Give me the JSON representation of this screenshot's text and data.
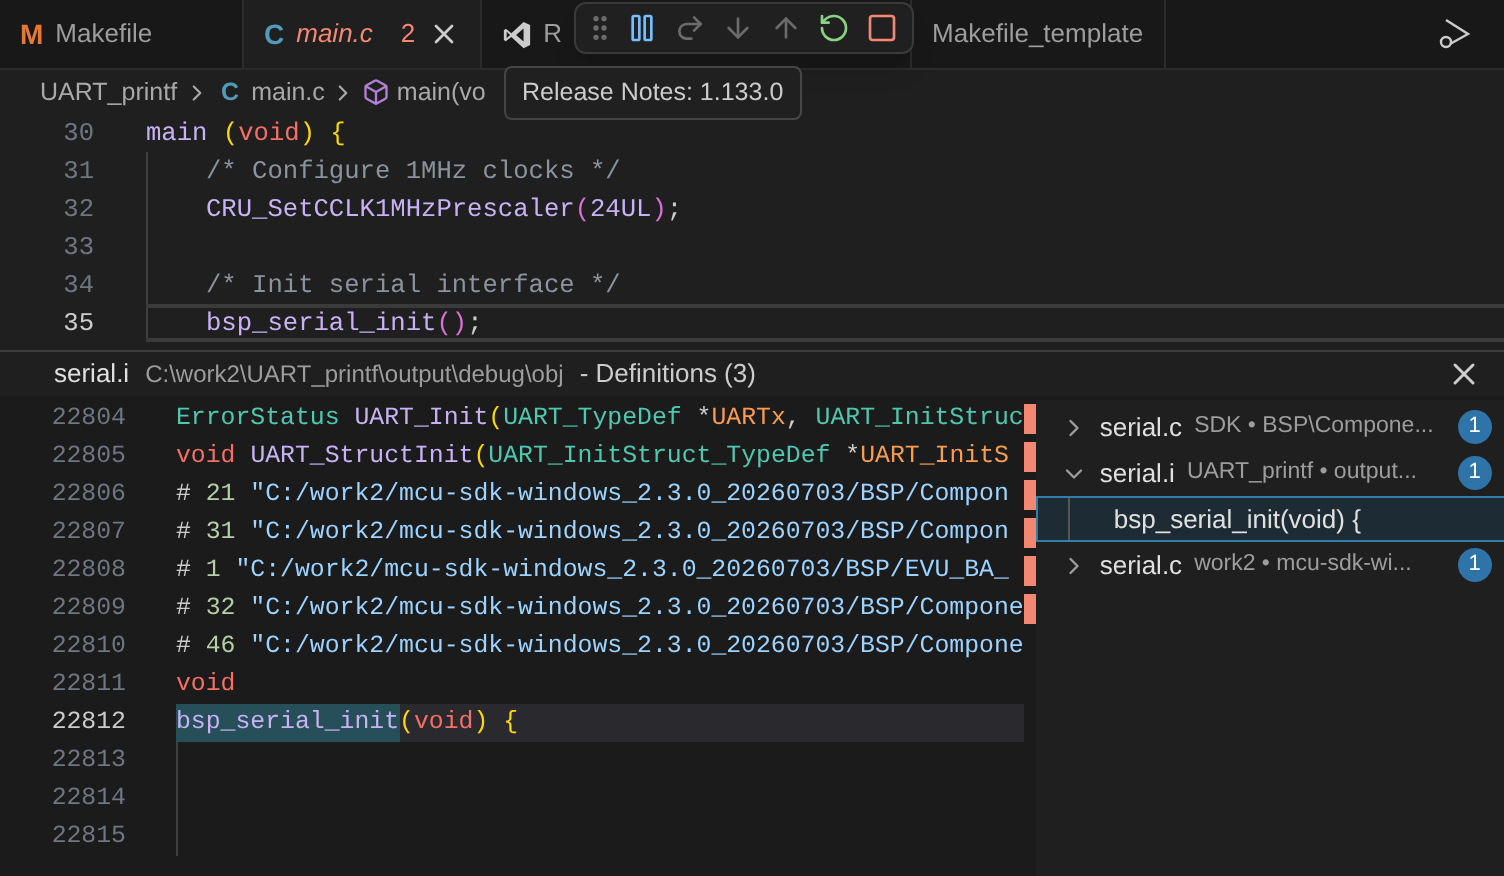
{
  "tabs": [
    {
      "label": "Makefile",
      "icon_text": "M",
      "kind": "makefile",
      "selected": false,
      "preview": false
    },
    {
      "label": "main.c",
      "icon_text": "C",
      "kind": "c",
      "selected": true,
      "preview": true,
      "errors": "2"
    },
    {
      "label": "R",
      "kind": "vscode",
      "selected": false,
      "preview": false
    },
    {
      "label": "Makefile_template",
      "kind": "plain",
      "selected": false,
      "preview": false
    }
  ],
  "debug_toolbar": [
    {
      "kind": "grip"
    },
    {
      "kind": "pause",
      "disabled": false
    },
    {
      "kind": "step_over",
      "disabled": true
    },
    {
      "kind": "step_into",
      "disabled": true
    },
    {
      "kind": "step_out",
      "disabled": true
    },
    {
      "kind": "restart",
      "disabled": false
    },
    {
      "kind": "stop",
      "disabled": false
    }
  ],
  "breadcrumb": [
    {
      "kind": "folder",
      "label": "UART_printf"
    },
    {
      "kind": "file",
      "icon_text": "C",
      "label": "main.c"
    },
    {
      "kind": "symbol",
      "label": "main(vo"
    }
  ],
  "tooltip": "Release Notes: 1.133.0",
  "editor": {
    "lines": [
      {
        "number": "30",
        "current": false,
        "indented": false,
        "tokens": [
          {
            "text": "main ",
            "kind": "fn"
          },
          {
            "text": "(",
            "kind": "br1"
          },
          {
            "text": "void",
            "kind": "kw"
          },
          {
            "text": ") {",
            "kind": "br1"
          }
        ]
      },
      {
        "number": "31",
        "current": false,
        "indented": true,
        "tokens": [
          {
            "text": "/* Configure 1MHz clocks */",
            "kind": "cmt"
          }
        ]
      },
      {
        "number": "32",
        "current": false,
        "indented": true,
        "tokens": [
          {
            "text": "CRU_SetCCLK1MHzPrescaler",
            "kind": "fn"
          },
          {
            "text": "(",
            "kind": "br2"
          },
          {
            "text": "24UL",
            "kind": "num"
          },
          {
            "text": ")",
            "kind": "br2"
          },
          {
            "text": ";",
            "kind": "plain"
          }
        ]
      },
      {
        "number": "33",
        "current": false,
        "indented": true
      },
      {
        "number": "34",
        "current": false,
        "indented": true,
        "tokens": [
          {
            "text": "/* Init serial interface */",
            "kind": "cmt"
          }
        ]
      },
      {
        "number": "35",
        "current": true,
        "indented": true,
        "tokens": [
          {
            "text": "bsp_serial_init",
            "kind": "fn"
          },
          {
            "text": "()",
            "kind": "br2"
          },
          {
            "text": ";",
            "kind": "plain"
          }
        ]
      }
    ]
  },
  "peek": {
    "file": "serial.i",
    "path": "C:\\work2\\UART_printf\\output\\debug\\obj",
    "title": "- Definitions (3)",
    "lines": [
      {
        "number": "22804",
        "current": false,
        "tokens": [
          {
            "text": "ErrorStatus ",
            "kind": "type"
          },
          {
            "text": "UART_Init",
            "kind": "fn"
          },
          {
            "text": "(",
            "kind": "br1"
          },
          {
            "text": "UART_TypeDef",
            "kind": "type"
          },
          {
            "text": " *",
            "kind": "plain"
          },
          {
            "text": "UARTx",
            "kind": "param"
          },
          {
            "text": ", ",
            "kind": "plain"
          },
          {
            "text": "UART_InitStruc",
            "kind": "type"
          }
        ]
      },
      {
        "number": "22805",
        "current": false,
        "tokens": [
          {
            "text": "void ",
            "kind": "kw"
          },
          {
            "text": "UART_StructInit",
            "kind": "fn"
          },
          {
            "text": "(",
            "kind": "br1"
          },
          {
            "text": "UART_InitStruct_TypeDef",
            "kind": "type"
          },
          {
            "text": " *",
            "kind": "plain"
          },
          {
            "text": "UART_InitS",
            "kind": "param"
          }
        ]
      },
      {
        "number": "22806",
        "current": false,
        "tokens": [
          {
            "text": "# ",
            "kind": "plain"
          },
          {
            "text": "21",
            "kind": "num2"
          },
          {
            "text": " \"C:/work2/mcu-sdk-windows_2.3.0_20260703/BSP/Compon",
            "kind": "str"
          }
        ]
      },
      {
        "number": "22807",
        "current": false,
        "tokens": [
          {
            "text": "# ",
            "kind": "plain"
          },
          {
            "text": "31",
            "kind": "num2"
          },
          {
            "text": " \"C:/work2/mcu-sdk-windows_2.3.0_20260703/BSP/Compon",
            "kind": "str"
          }
        ]
      },
      {
        "number": "22808",
        "current": false,
        "tokens": [
          {
            "text": "# ",
            "kind": "plain"
          },
          {
            "text": "1",
            "kind": "num2"
          },
          {
            "text": " \"C:/work2/mcu-sdk-windows_2.3.0_20260703/BSP/EVU_BA_",
            "kind": "str"
          }
        ]
      },
      {
        "number": "22809",
        "current": false,
        "tokens": [
          {
            "text": "# ",
            "kind": "plain"
          },
          {
            "text": "32",
            "kind": "num2"
          },
          {
            "text": " \"C:/work2/mcu-sdk-windows_2.3.0_20260703/BSP/Compone",
            "kind": "str"
          }
        ]
      },
      {
        "number": "22810",
        "current": false,
        "tokens": [
          {
            "text": "# ",
            "kind": "plain"
          },
          {
            "text": "46",
            "kind": "num2"
          },
          {
            "text": " \"C:/work2/mcu-sdk-windows_2.3.0_20260703/BSP/Compone",
            "kind": "str"
          }
        ]
      },
      {
        "number": "22811",
        "current": false,
        "tokens": [
          {
            "text": "void",
            "kind": "kw"
          }
        ]
      },
      {
        "number": "22812",
        "current": true,
        "tokens": [
          {
            "text": "bsp_serial_init",
            "kind": "fn_match"
          },
          {
            "text": "(",
            "kind": "br1"
          },
          {
            "text": "void",
            "kind": "kw"
          },
          {
            "text": ") {",
            "kind": "br1"
          }
        ]
      },
      {
        "number": "22813",
        "current": false
      },
      {
        "number": "22814",
        "current": false
      },
      {
        "number": "22815",
        "current": false
      }
    ],
    "references": [
      {
        "file": "serial.c",
        "detail": "SDK • BSP\\Compone...",
        "count": "1",
        "expanded": false
      },
      {
        "file": "serial.i",
        "detail": "UART_printf • output...",
        "count": "1",
        "expanded": true,
        "children": [
          {
            "label": "bsp_serial_init(void) {",
            "selected": true
          }
        ]
      },
      {
        "file": "serial.c",
        "detail": "work2 • mcu-sdk-wi...",
        "count": "1",
        "expanded": false
      }
    ]
  }
}
